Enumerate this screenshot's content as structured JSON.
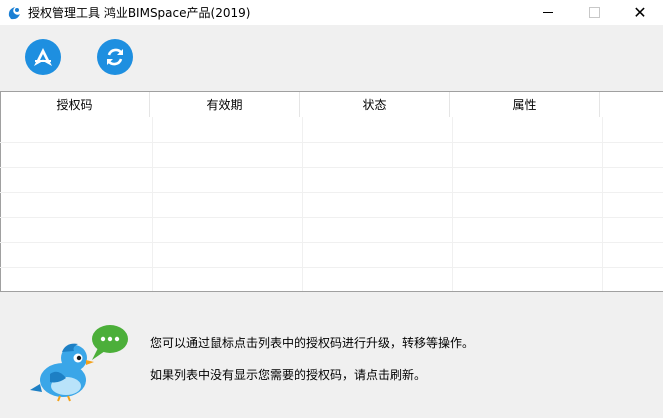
{
  "window": {
    "title": "授权管理工具 鸿业BIMSpace产品(2019)",
    "close_glyph": "✕"
  },
  "toolbar": {
    "upgrade_icon": "upgrade-icon",
    "refresh_icon": "refresh-icon",
    "accent_color": "#1e8fe0"
  },
  "table": {
    "columns": [
      "授权码",
      "有效期",
      "状态",
      "属性"
    ],
    "rows": []
  },
  "info": {
    "line1": "您可以通过鼠标点击列表中的授权码进行升级，转移等操作。",
    "line2": "如果列表中没有显示您需要的授权码，请点击刷新。"
  }
}
